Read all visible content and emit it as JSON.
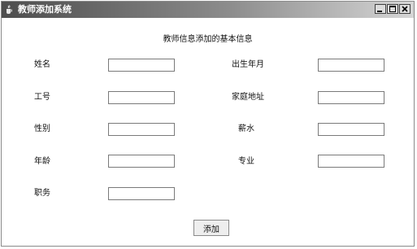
{
  "window": {
    "title": "教师添加系统",
    "buttons": {
      "minimize": "minimize",
      "maximize": "maximize",
      "close": "close"
    }
  },
  "form": {
    "heading": "教师信息添加的基本信息",
    "fields": [
      {
        "label": "姓名",
        "value": ""
      },
      {
        "label": "出生年月",
        "value": ""
      },
      {
        "label": "工号",
        "value": ""
      },
      {
        "label": "家庭地址",
        "value": ""
      },
      {
        "label": "性别",
        "value": ""
      },
      {
        "label": "薪水",
        "value": ""
      },
      {
        "label": "年龄",
        "value": ""
      },
      {
        "label": "专业",
        "value": ""
      },
      {
        "label": "职务",
        "value": ""
      }
    ],
    "submit_label": "添加"
  }
}
